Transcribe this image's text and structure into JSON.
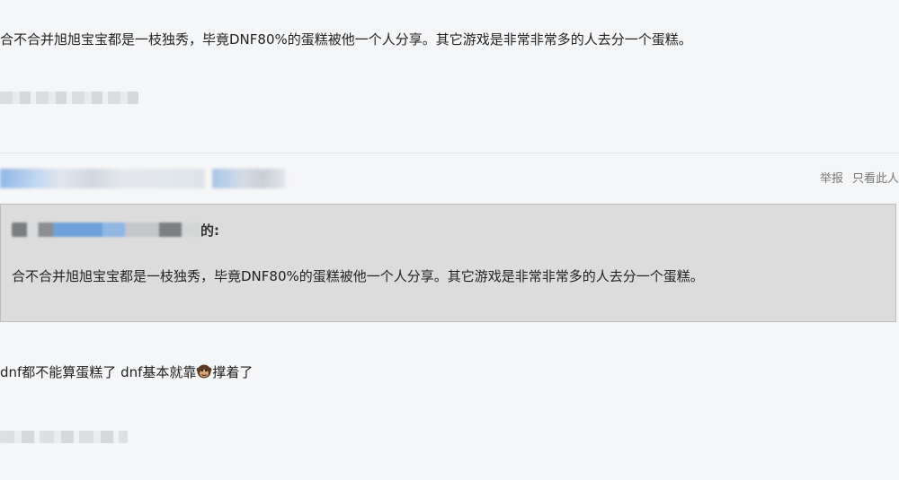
{
  "post1": {
    "body": "合不合并旭旭宝宝都是一枝独秀，毕竟DNF80%的蛋糕被他一个人分享。其它游戏是非常非常多的人去分一个蛋糕。"
  },
  "post2": {
    "actions": {
      "report": "举报",
      "only_this_user": "只看此人"
    },
    "quote": {
      "author_suffix": "的:",
      "text": "合不合并旭旭宝宝都是一枝独秀，毕竟DNF80%的蛋糕被他一个人分享。其它游戏是非常非常多的人去分一个蛋糕。"
    },
    "reply": {
      "text_before": "dnf都不能算蛋糕了 dnf基本就靠",
      "emoji_icon": "monkey-emoji-icon",
      "text_after": "撑着了"
    }
  }
}
